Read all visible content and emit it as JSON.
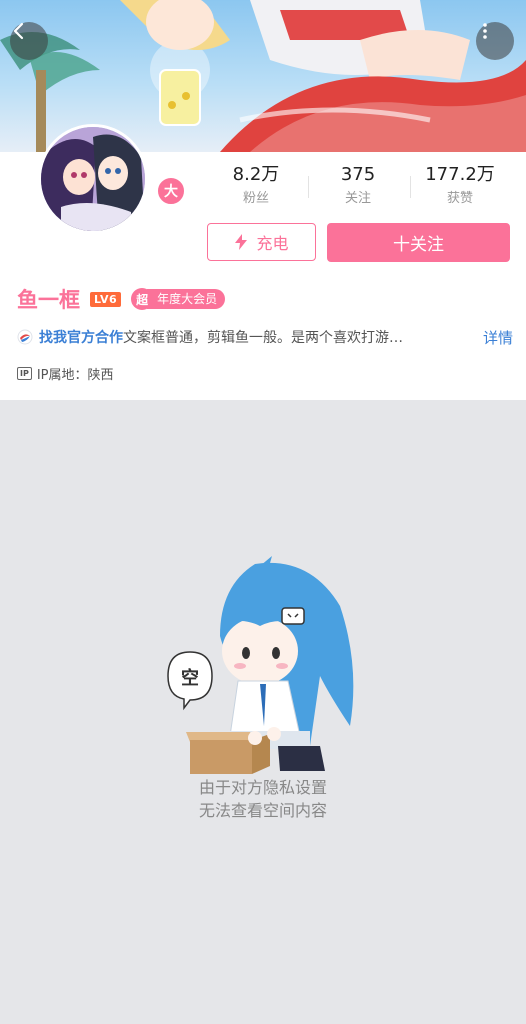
{
  "banner": {
    "image": "anime-character-banner"
  },
  "nav": {
    "back_icon": "chevron-left-icon",
    "more_icon": "more-vertical-icon"
  },
  "profile": {
    "avatar": "user-avatar",
    "vip_badge": "大",
    "stats": [
      {
        "value": "8.2万",
        "label": "粉丝"
      },
      {
        "value": "375",
        "label": "关注"
      },
      {
        "value": "177.2万",
        "label": "获赞"
      }
    ],
    "charge_label": "充电",
    "follow_label": "十关注",
    "username": "鱼一框",
    "level": "LV6",
    "vip_short": "超",
    "vip_label": "年度大会员",
    "bio_link": "找我官方合作",
    "bio_text": "文案框普通，剪辑鱼一般。是两个喜欢打游…",
    "bio_more": "详情",
    "ip_icon": "IP",
    "ip_text": "IP属地：陕西"
  },
  "empty_state": {
    "bubble": "空",
    "line1": "由于对方隐私设置",
    "line2": "无法查看空间内容"
  },
  "colors": {
    "accent": "#fb7299",
    "link": "#3a7fd5",
    "background": "#e5e6e9"
  }
}
